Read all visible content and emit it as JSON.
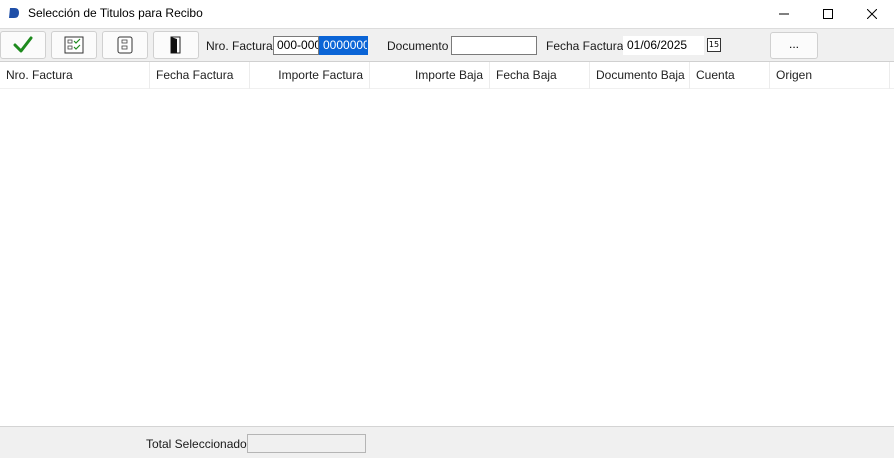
{
  "window": {
    "title": "Selección de Titulos para Recibo"
  },
  "toolbar": {
    "nro_factura_label": "Nro. Factura",
    "nro_factura_prefix": "000-000",
    "nro_factura_number": "0000000",
    "documento_label": "Documento",
    "documento_value": "",
    "fecha_factura_label": "Fecha Factura",
    "fecha_factura_value": "01/06/2025",
    "calendar_day": "15",
    "more_button_label": "..."
  },
  "grid": {
    "columns": [
      "Nro. Factura",
      "Fecha Factura",
      "Importe Factura",
      "Importe Baja",
      "Fecha Baja",
      "Documento Baja",
      "Cuenta",
      "Origen"
    ],
    "rows": []
  },
  "footer": {
    "total_label": "Total Seleccionado",
    "total_value": ""
  },
  "colors": {
    "accept_check": "#1e8a1e",
    "selection": "#0a64d6",
    "app_icon": "#1f4fa8"
  }
}
